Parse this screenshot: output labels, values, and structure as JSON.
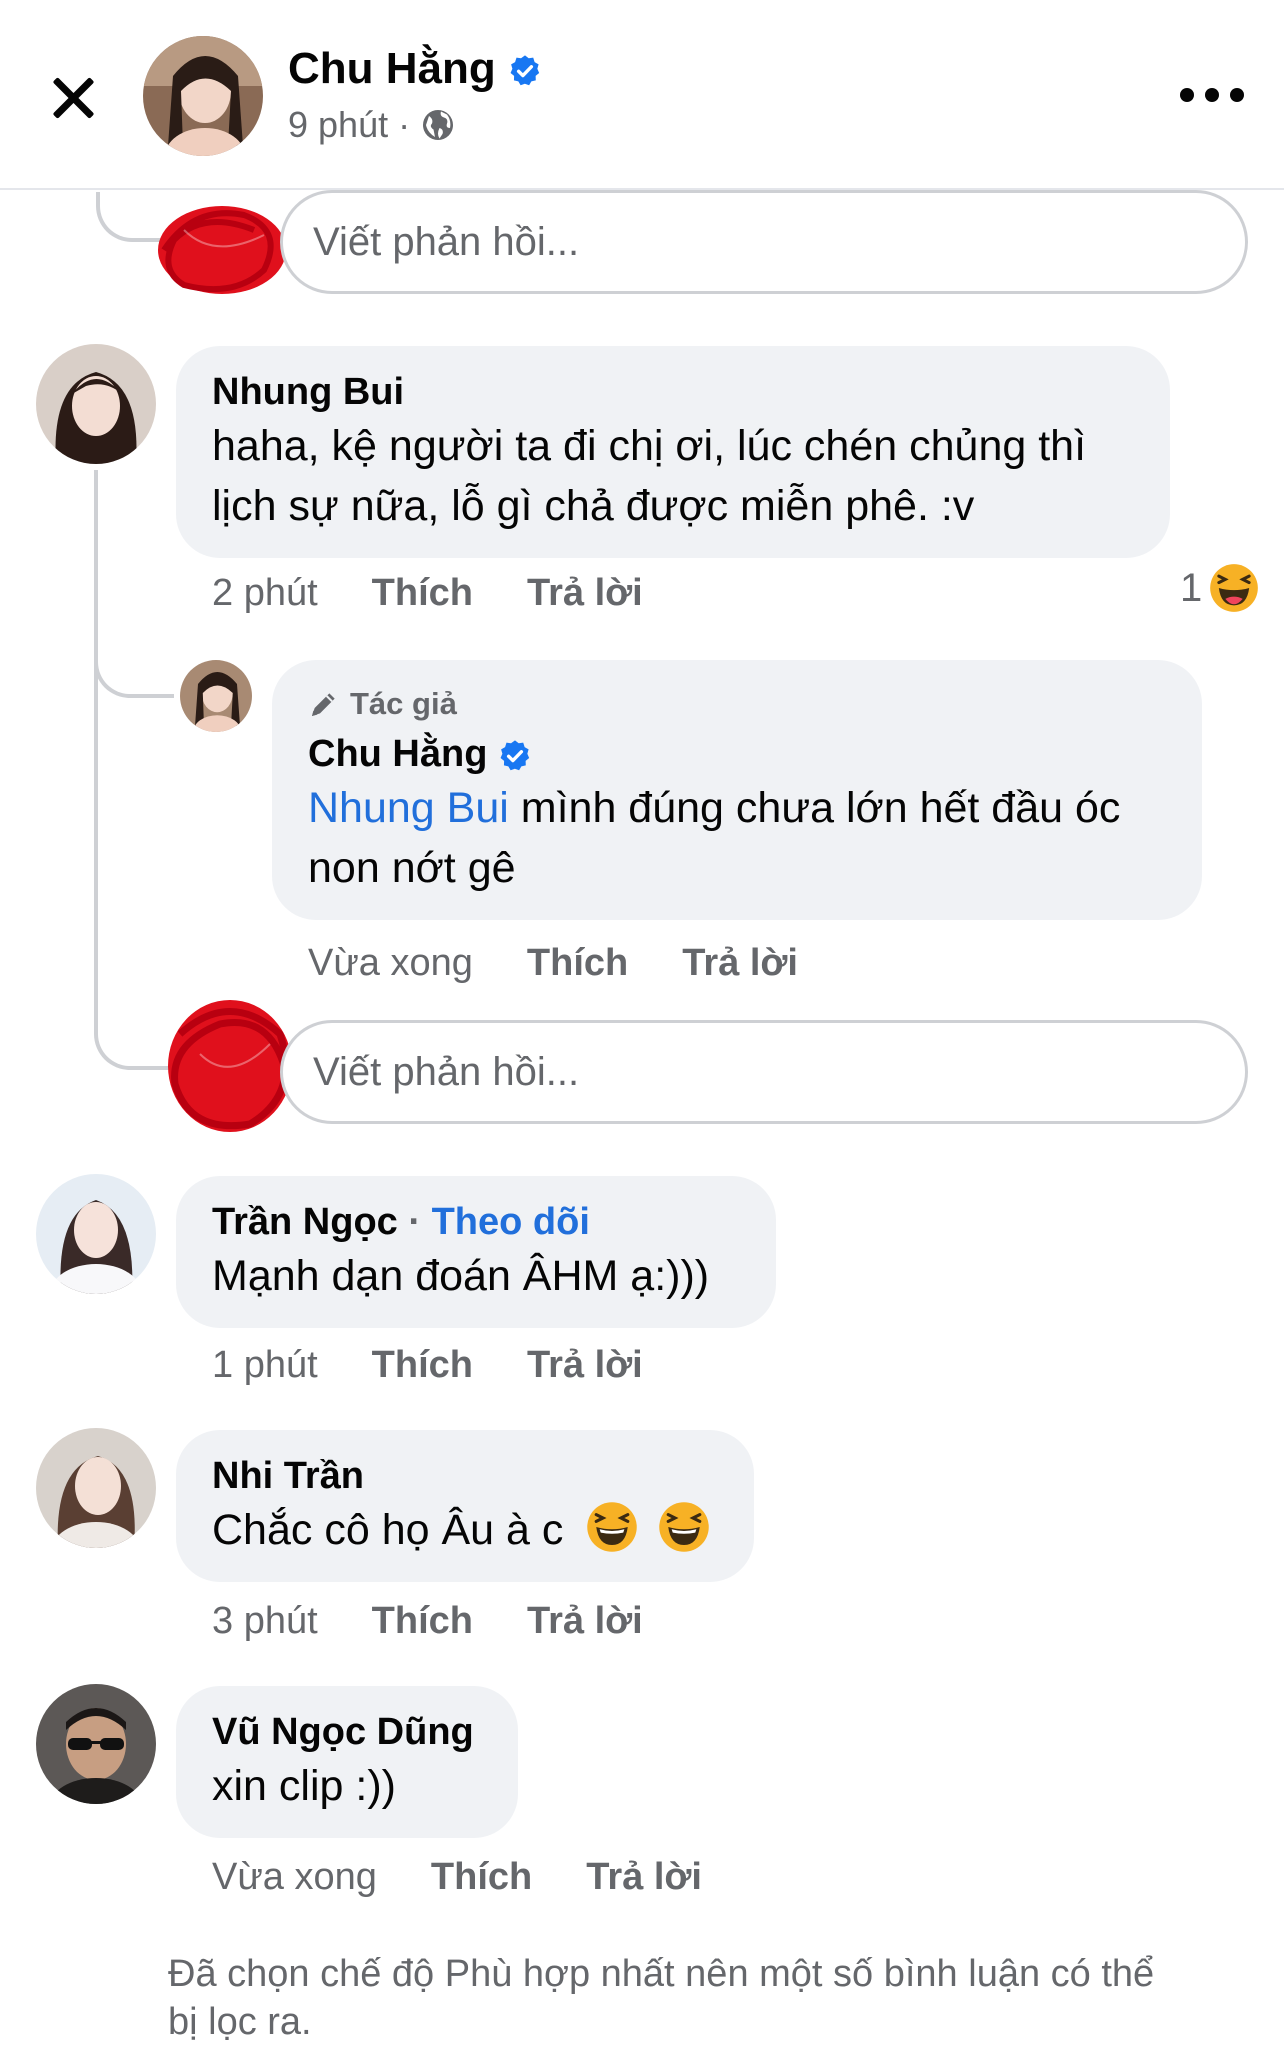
{
  "header": {
    "name": "Chu Hằng",
    "time": "9 phút",
    "separator": "·"
  },
  "reply_placeholder": "Viết phản hồi...",
  "comments": [
    {
      "name": "Nhung Bui",
      "text": "haha, kệ người ta đi chị ơi, lúc chén chủng thì lịch sự nữa, lỗ gì chả được miễn phê. :v",
      "time": "2 phút",
      "like": "Thích",
      "reply": "Trả lời",
      "reaction_count": "1"
    },
    {
      "name": "Chu Hằng",
      "author_label": "Tác giả",
      "mention": "Nhung Bui",
      "text": " mình đúng chưa lớn hết đầu óc non nớt gê",
      "time": "Vừa xong",
      "like": "Thích",
      "reply": "Trả lời"
    },
    {
      "name": "Trần Ngọc",
      "follow": "Theo dõi",
      "text": "Mạnh dạn đoán ÂHM ạ:)))",
      "time": "1 phút",
      "like": "Thích",
      "reply": "Trả lời"
    },
    {
      "name": "Nhi Trần",
      "text": "Chắc cô họ Âu à c",
      "time": "3 phút",
      "like": "Thích",
      "reply": "Trả lời"
    },
    {
      "name": "Vũ Ngọc Dũng",
      "text": "xin clip :))",
      "time": "Vừa xong",
      "like": "Thích",
      "reply": "Trả lời"
    }
  ],
  "footer_note": "Đã chọn chế độ Phù hợp nhất nên một số bình luận có thể bị lọc ra.",
  "colors": {
    "link": "#216fdb",
    "verified": "#1877f2",
    "bubble": "#f0f2f5",
    "muted": "#65676b",
    "scribble": "#e0101c"
  }
}
